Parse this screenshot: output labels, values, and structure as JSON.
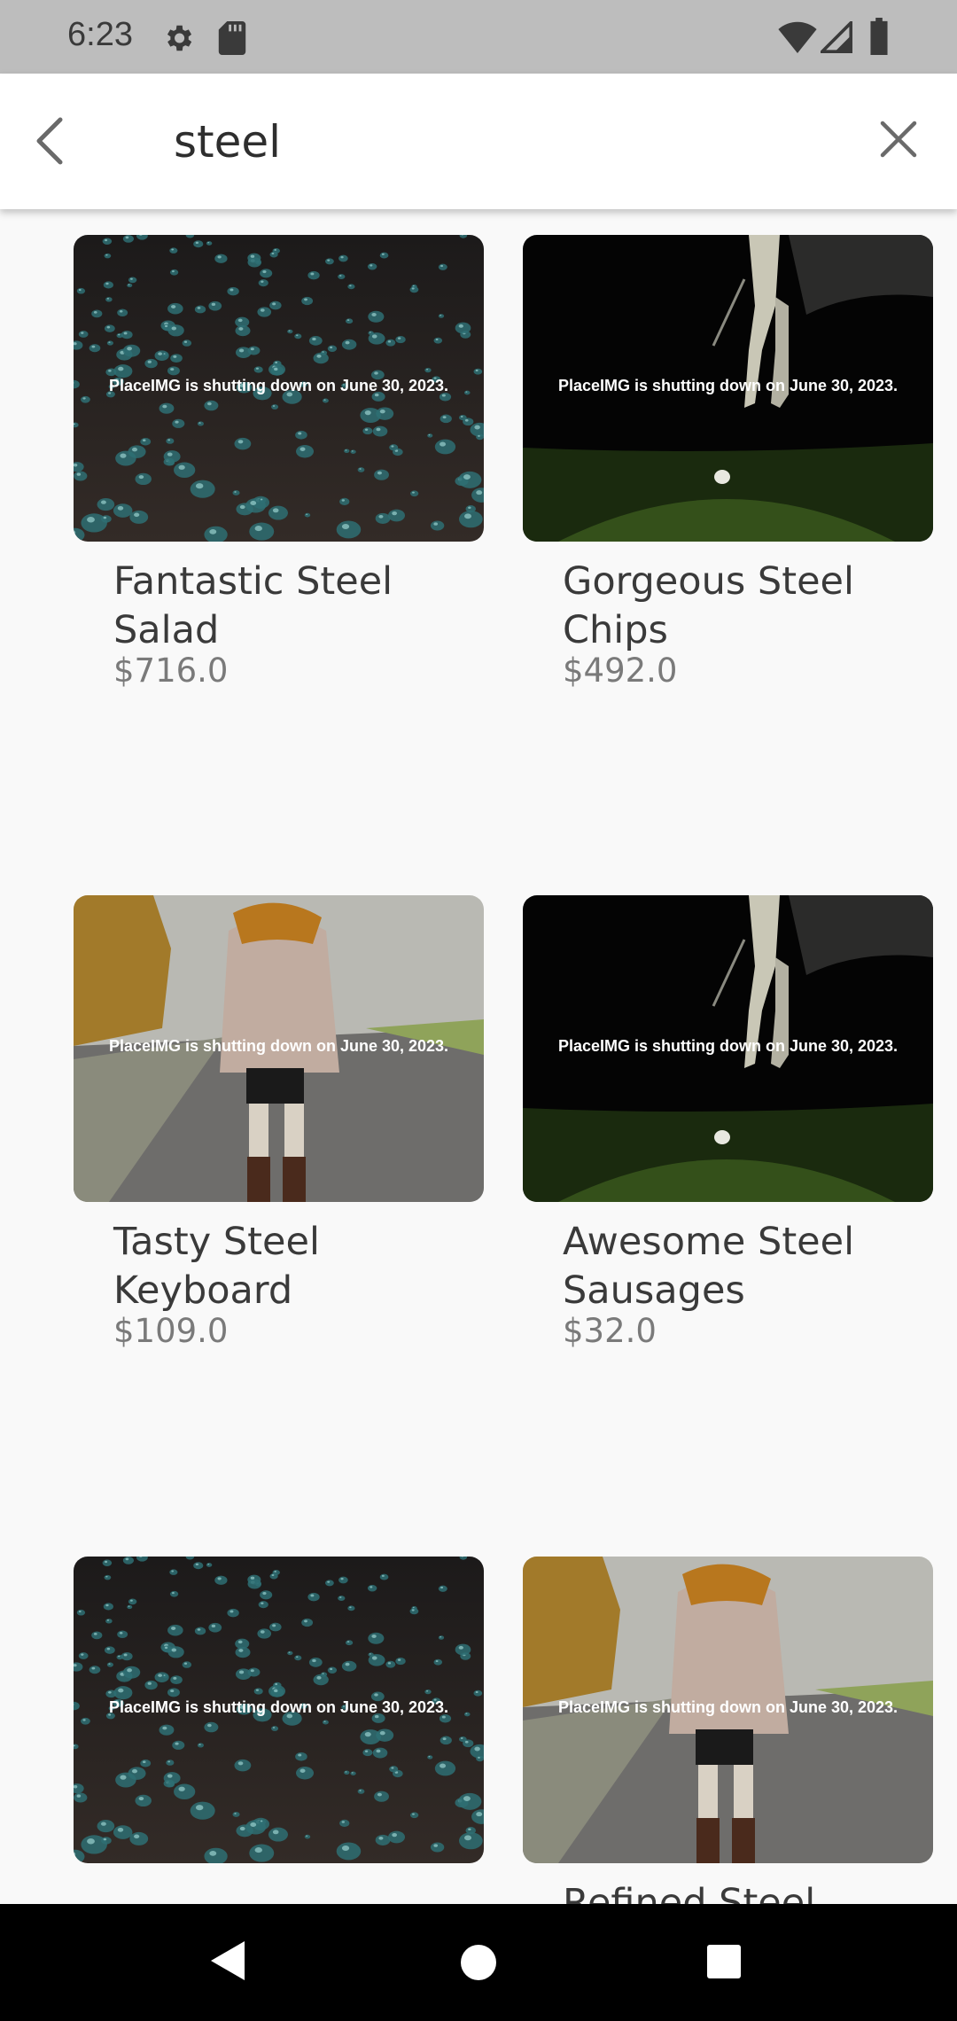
{
  "status": {
    "time": "6:23",
    "icons": [
      "settings-icon",
      "sd-card-icon",
      "wifi-icon",
      "signal-icon",
      "battery-icon"
    ]
  },
  "search": {
    "query": "steel",
    "back_icon": "chevron-left-icon",
    "clear_icon": "close-icon"
  },
  "products": [
    {
      "name": "Fantastic Steel Salad",
      "price": "$716.0",
      "image_text": "PlaceIMG is shutting down on June 30, 2023.",
      "image": "water-drops"
    },
    {
      "name": "Gorgeous Steel Chips",
      "price": "$492.0",
      "image_text": "PlaceIMG is shutting down on June 30, 2023.",
      "image": "golfer"
    },
    {
      "name": "Tasty Steel Keyboard",
      "price": "$109.0",
      "image_text": "PlaceIMG is shutting down on June 30, 2023.",
      "image": "woman-road"
    },
    {
      "name": "Awesome Steel Sausages",
      "price": "$32.0",
      "image_text": "PlaceIMG is shutting down on June 30, 2023.",
      "image": "golfer"
    },
    {
      "name": "",
      "price": "",
      "image_text": "PlaceIMG is shutting down on June 30, 2023.",
      "image": "water-drops"
    },
    {
      "name": "Refined Steel",
      "price": "",
      "image_text": "PlaceIMG is shutting down on June 30, 2023.",
      "image": "woman-road"
    }
  ],
  "navbar": {
    "icons": [
      "back-triangle-icon",
      "home-circle-icon",
      "recents-square-icon"
    ]
  },
  "colors": {
    "statusbar": "#bdbdbd",
    "background": "#f9f9f9",
    "text": "#3a3a3a",
    "price": "#7a7a7a"
  }
}
